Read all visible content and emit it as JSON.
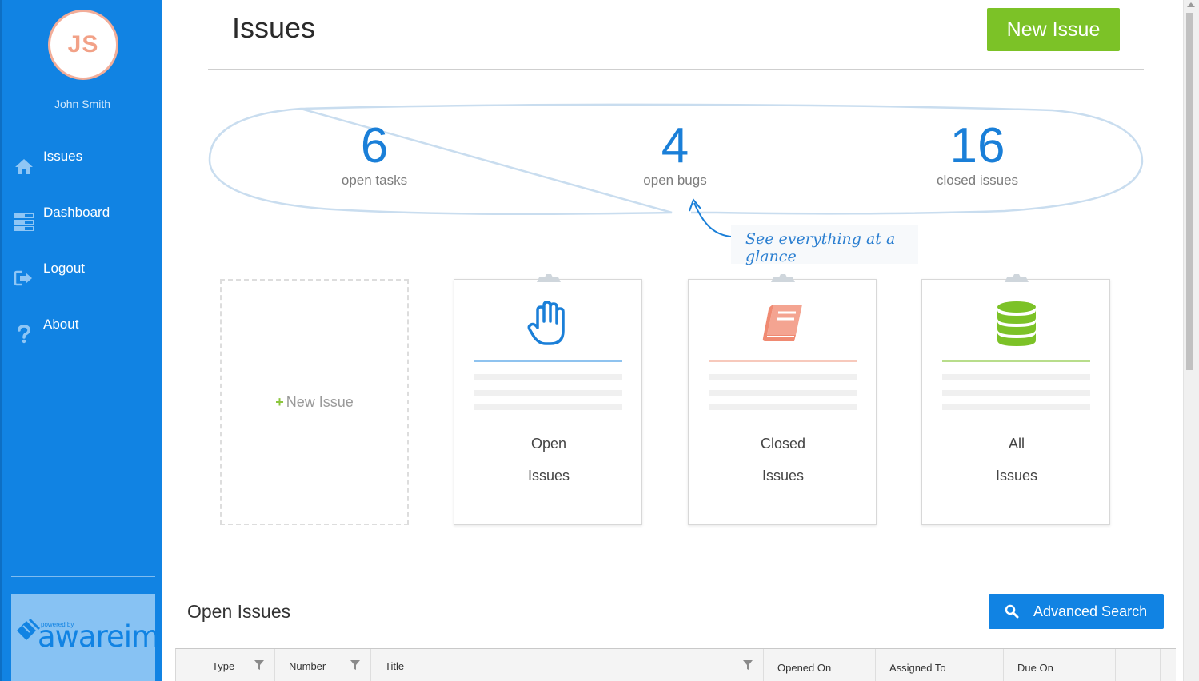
{
  "user": {
    "initials": "JS",
    "name": "John Smith"
  },
  "sidebar": {
    "items": [
      {
        "label": "Issues",
        "icon": "home-icon"
      },
      {
        "label": "Dashboard",
        "icon": "dashboard-icon"
      },
      {
        "label": "Logout",
        "icon": "logout-icon"
      },
      {
        "label": "About",
        "icon": "question-icon"
      }
    ],
    "powered_small": "powered by",
    "powered_brand": "awareim"
  },
  "header": {
    "title": "Issues",
    "new_issue_label": "New Issue"
  },
  "stats": [
    {
      "value": "6",
      "label": "open tasks"
    },
    {
      "value": "4",
      "label": "open bugs"
    },
    {
      "value": "16",
      "label": "closed issues"
    }
  ],
  "glance_text": "See everything at a glance",
  "new_card_label": "New Issue",
  "cards": [
    {
      "line1": "Open",
      "line2": "Issues",
      "icon": "hand-icon",
      "accent": "#8fc3ef"
    },
    {
      "line1": "Closed",
      "line2": "Issues",
      "icon": "book-icon",
      "accent": "#f7c9bc"
    },
    {
      "line1": "All",
      "line2": "Issues",
      "icon": "database-icon",
      "accent": "#b8dd8b"
    }
  ],
  "open_issues": {
    "title": "Open Issues",
    "advanced_search_label": "Advanced Search",
    "columns": [
      "Type",
      "Number",
      "Title",
      "Opened On",
      "Assigned To",
      "Due On"
    ]
  },
  "colors": {
    "primary": "#1183e3",
    "success": "#7cc227",
    "avatar_accent": "#f2a187"
  }
}
